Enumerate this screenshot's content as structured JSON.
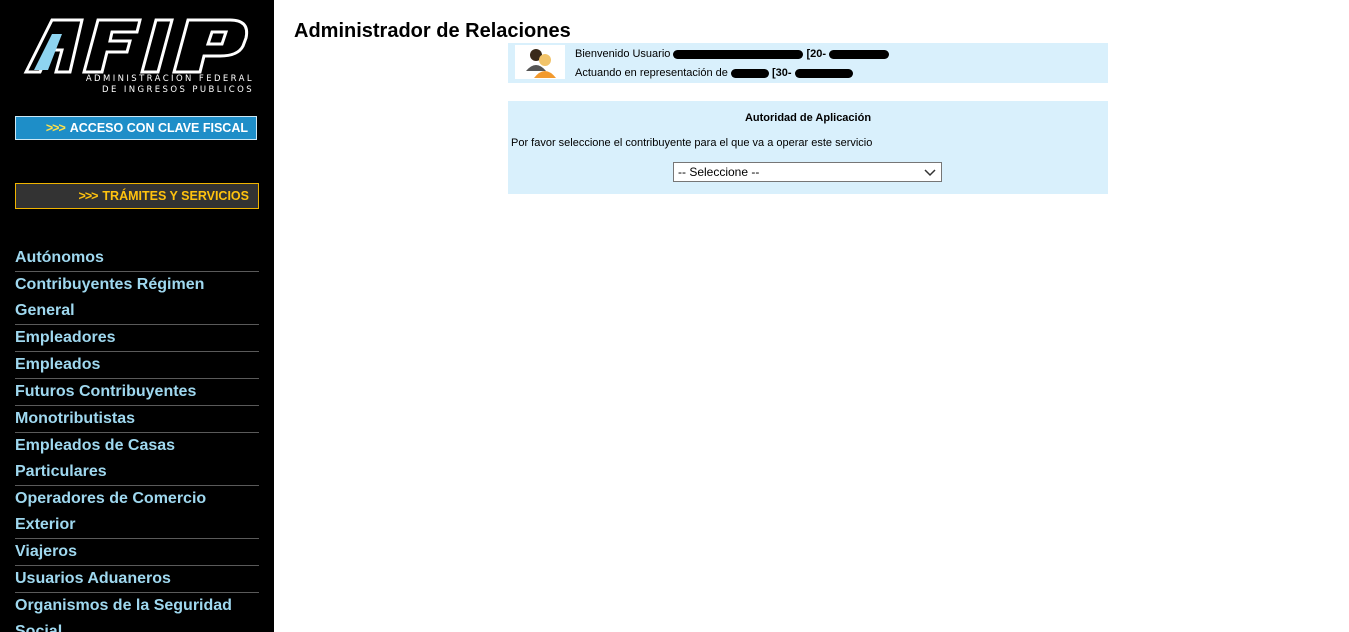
{
  "sidebar": {
    "logo": {
      "brand": "AFIP",
      "subtitle_line1": "ADMINISTRACION FEDERAL",
      "subtitle_line2": "DE INGRESOS PUBLICOS"
    },
    "clave_fiscal": {
      "arrows": ">>>",
      "label": "ACCESO CON CLAVE FISCAL"
    },
    "tramites": {
      "arrows": ">>>",
      "label": "TRÁMITES Y SERVICIOS"
    },
    "nav_items": [
      "Autónomos",
      "Contribuyentes Régimen General",
      "Empleadores",
      "Empleados",
      "Futuros Contribuyentes",
      "Monotributistas",
      "Empleados de Casas Particulares",
      "Operadores de Comercio Exterior",
      "Viajeros",
      "Usuarios Aduaneros",
      "Organismos de la Seguridad Social"
    ]
  },
  "main": {
    "title": "Administrador de Relaciones",
    "user": {
      "welcome_label": "Bienvenido Usuario",
      "welcome_id": "[20-",
      "representation_label": "Actuando en representación de",
      "representation_id": "[30-"
    },
    "authority": {
      "title": "Autoridad de Aplicación",
      "instruction": "Por favor seleccione el contribuyente para el que va a operar este servicio",
      "select_value": "-- Seleccione --"
    }
  },
  "colors": {
    "sidebar_bg": "#000000",
    "nav_text": "#9fd8ef",
    "clave_bg": "#1e8ec8",
    "tramites_text": "#ffc20e",
    "panel_bg": "#d9f0fc"
  },
  "icons": [
    "afip-logo-icon",
    "users-icon",
    "chevron-down-icon"
  ]
}
